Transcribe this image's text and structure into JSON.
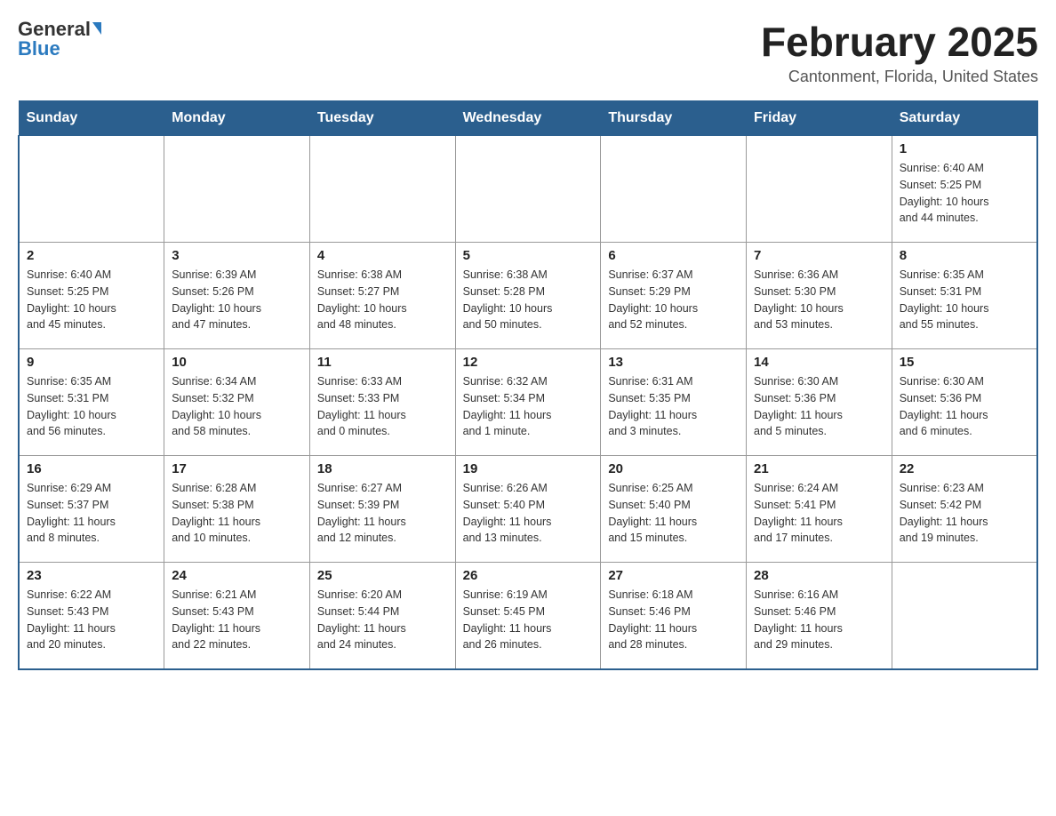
{
  "header": {
    "logo_general": "General",
    "logo_blue": "Blue",
    "month_title": "February 2025",
    "location": "Cantonment, Florida, United States"
  },
  "days_of_week": [
    "Sunday",
    "Monday",
    "Tuesday",
    "Wednesday",
    "Thursday",
    "Friday",
    "Saturday"
  ],
  "weeks": [
    [
      {
        "day": "",
        "info": ""
      },
      {
        "day": "",
        "info": ""
      },
      {
        "day": "",
        "info": ""
      },
      {
        "day": "",
        "info": ""
      },
      {
        "day": "",
        "info": ""
      },
      {
        "day": "",
        "info": ""
      },
      {
        "day": "1",
        "info": "Sunrise: 6:40 AM\nSunset: 5:25 PM\nDaylight: 10 hours\nand 44 minutes."
      }
    ],
    [
      {
        "day": "2",
        "info": "Sunrise: 6:40 AM\nSunset: 5:25 PM\nDaylight: 10 hours\nand 45 minutes."
      },
      {
        "day": "3",
        "info": "Sunrise: 6:39 AM\nSunset: 5:26 PM\nDaylight: 10 hours\nand 47 minutes."
      },
      {
        "day": "4",
        "info": "Sunrise: 6:38 AM\nSunset: 5:27 PM\nDaylight: 10 hours\nand 48 minutes."
      },
      {
        "day": "5",
        "info": "Sunrise: 6:38 AM\nSunset: 5:28 PM\nDaylight: 10 hours\nand 50 minutes."
      },
      {
        "day": "6",
        "info": "Sunrise: 6:37 AM\nSunset: 5:29 PM\nDaylight: 10 hours\nand 52 minutes."
      },
      {
        "day": "7",
        "info": "Sunrise: 6:36 AM\nSunset: 5:30 PM\nDaylight: 10 hours\nand 53 minutes."
      },
      {
        "day": "8",
        "info": "Sunrise: 6:35 AM\nSunset: 5:31 PM\nDaylight: 10 hours\nand 55 minutes."
      }
    ],
    [
      {
        "day": "9",
        "info": "Sunrise: 6:35 AM\nSunset: 5:31 PM\nDaylight: 10 hours\nand 56 minutes."
      },
      {
        "day": "10",
        "info": "Sunrise: 6:34 AM\nSunset: 5:32 PM\nDaylight: 10 hours\nand 58 minutes."
      },
      {
        "day": "11",
        "info": "Sunrise: 6:33 AM\nSunset: 5:33 PM\nDaylight: 11 hours\nand 0 minutes."
      },
      {
        "day": "12",
        "info": "Sunrise: 6:32 AM\nSunset: 5:34 PM\nDaylight: 11 hours\nand 1 minute."
      },
      {
        "day": "13",
        "info": "Sunrise: 6:31 AM\nSunset: 5:35 PM\nDaylight: 11 hours\nand 3 minutes."
      },
      {
        "day": "14",
        "info": "Sunrise: 6:30 AM\nSunset: 5:36 PM\nDaylight: 11 hours\nand 5 minutes."
      },
      {
        "day": "15",
        "info": "Sunrise: 6:30 AM\nSunset: 5:36 PM\nDaylight: 11 hours\nand 6 minutes."
      }
    ],
    [
      {
        "day": "16",
        "info": "Sunrise: 6:29 AM\nSunset: 5:37 PM\nDaylight: 11 hours\nand 8 minutes."
      },
      {
        "day": "17",
        "info": "Sunrise: 6:28 AM\nSunset: 5:38 PM\nDaylight: 11 hours\nand 10 minutes."
      },
      {
        "day": "18",
        "info": "Sunrise: 6:27 AM\nSunset: 5:39 PM\nDaylight: 11 hours\nand 12 minutes."
      },
      {
        "day": "19",
        "info": "Sunrise: 6:26 AM\nSunset: 5:40 PM\nDaylight: 11 hours\nand 13 minutes."
      },
      {
        "day": "20",
        "info": "Sunrise: 6:25 AM\nSunset: 5:40 PM\nDaylight: 11 hours\nand 15 minutes."
      },
      {
        "day": "21",
        "info": "Sunrise: 6:24 AM\nSunset: 5:41 PM\nDaylight: 11 hours\nand 17 minutes."
      },
      {
        "day": "22",
        "info": "Sunrise: 6:23 AM\nSunset: 5:42 PM\nDaylight: 11 hours\nand 19 minutes."
      }
    ],
    [
      {
        "day": "23",
        "info": "Sunrise: 6:22 AM\nSunset: 5:43 PM\nDaylight: 11 hours\nand 20 minutes."
      },
      {
        "day": "24",
        "info": "Sunrise: 6:21 AM\nSunset: 5:43 PM\nDaylight: 11 hours\nand 22 minutes."
      },
      {
        "day": "25",
        "info": "Sunrise: 6:20 AM\nSunset: 5:44 PM\nDaylight: 11 hours\nand 24 minutes."
      },
      {
        "day": "26",
        "info": "Sunrise: 6:19 AM\nSunset: 5:45 PM\nDaylight: 11 hours\nand 26 minutes."
      },
      {
        "day": "27",
        "info": "Sunrise: 6:18 AM\nSunset: 5:46 PM\nDaylight: 11 hours\nand 28 minutes."
      },
      {
        "day": "28",
        "info": "Sunrise: 6:16 AM\nSunset: 5:46 PM\nDaylight: 11 hours\nand 29 minutes."
      },
      {
        "day": "",
        "info": ""
      }
    ]
  ]
}
